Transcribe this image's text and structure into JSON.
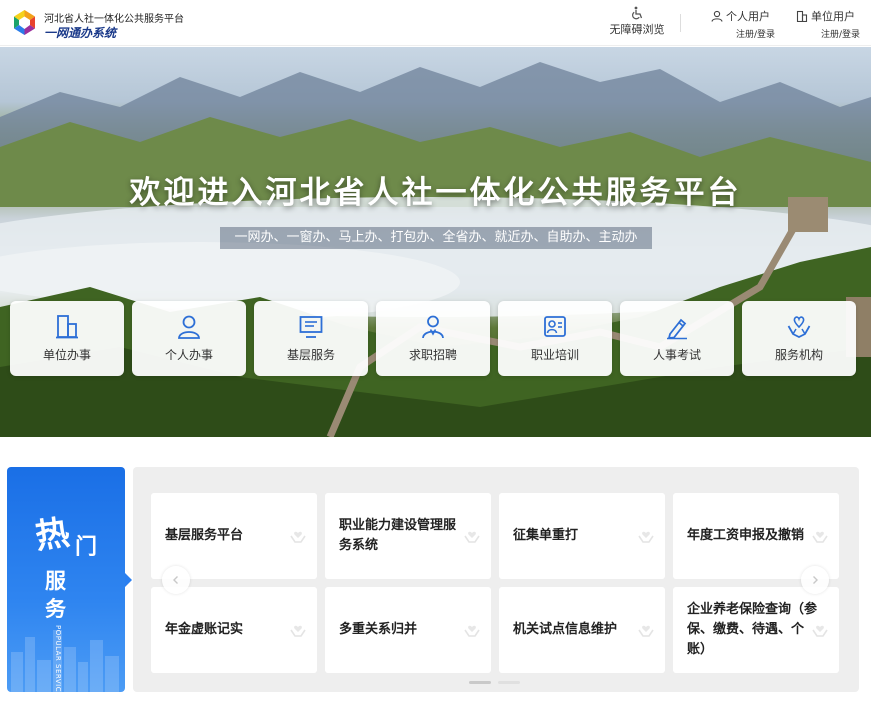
{
  "header": {
    "logo_line1": "河北省人社一体化公共服务平台",
    "logo_line2": "一网通办系统",
    "accessibility": "无障碍浏览",
    "personal_user": "个人用户",
    "personal_user_sub": "注册/登录",
    "unit_user": "单位用户",
    "unit_user_sub": "注册/登录"
  },
  "banner": {
    "title": "欢迎进入河北省人社一体化公共服务平台",
    "subtitle": "一网办、一窗办、马上办、打包办、全省办、就近办、自助办、主动办"
  },
  "quick_services": [
    {
      "label": "单位办事",
      "icon": "building-icon"
    },
    {
      "label": "个人办事",
      "icon": "person-icon"
    },
    {
      "label": "基层服务",
      "icon": "monitor-icon"
    },
    {
      "label": "求职招聘",
      "icon": "job-seeker-icon"
    },
    {
      "label": "职业培训",
      "icon": "training-icon"
    },
    {
      "label": "人事考试",
      "icon": "pen-exam-icon"
    },
    {
      "label": "服务机构",
      "icon": "heart-hands-icon"
    }
  ],
  "hot": {
    "char1": "热",
    "char2": "门",
    "char3": "服",
    "char4": "务",
    "english": "POPULAR SERVICES"
  },
  "hot_services": [
    {
      "label": "基层服务平台"
    },
    {
      "label": "职业能力建设管理服务系统"
    },
    {
      "label": "征集单重打"
    },
    {
      "label": "年度工资申报及撤销"
    },
    {
      "label": "年金虚账记实"
    },
    {
      "label": "多重关系归并"
    },
    {
      "label": "机关试点信息维护"
    },
    {
      "label": "企业养老保险查询（参保、缴费、待遇、个账）"
    }
  ],
  "colors": {
    "brand_blue": "#1a6fe6",
    "icon_blue": "#2d6fd6",
    "logo_text": "#1b3a8a"
  },
  "carousel": {
    "pages": 2,
    "active": 1
  }
}
